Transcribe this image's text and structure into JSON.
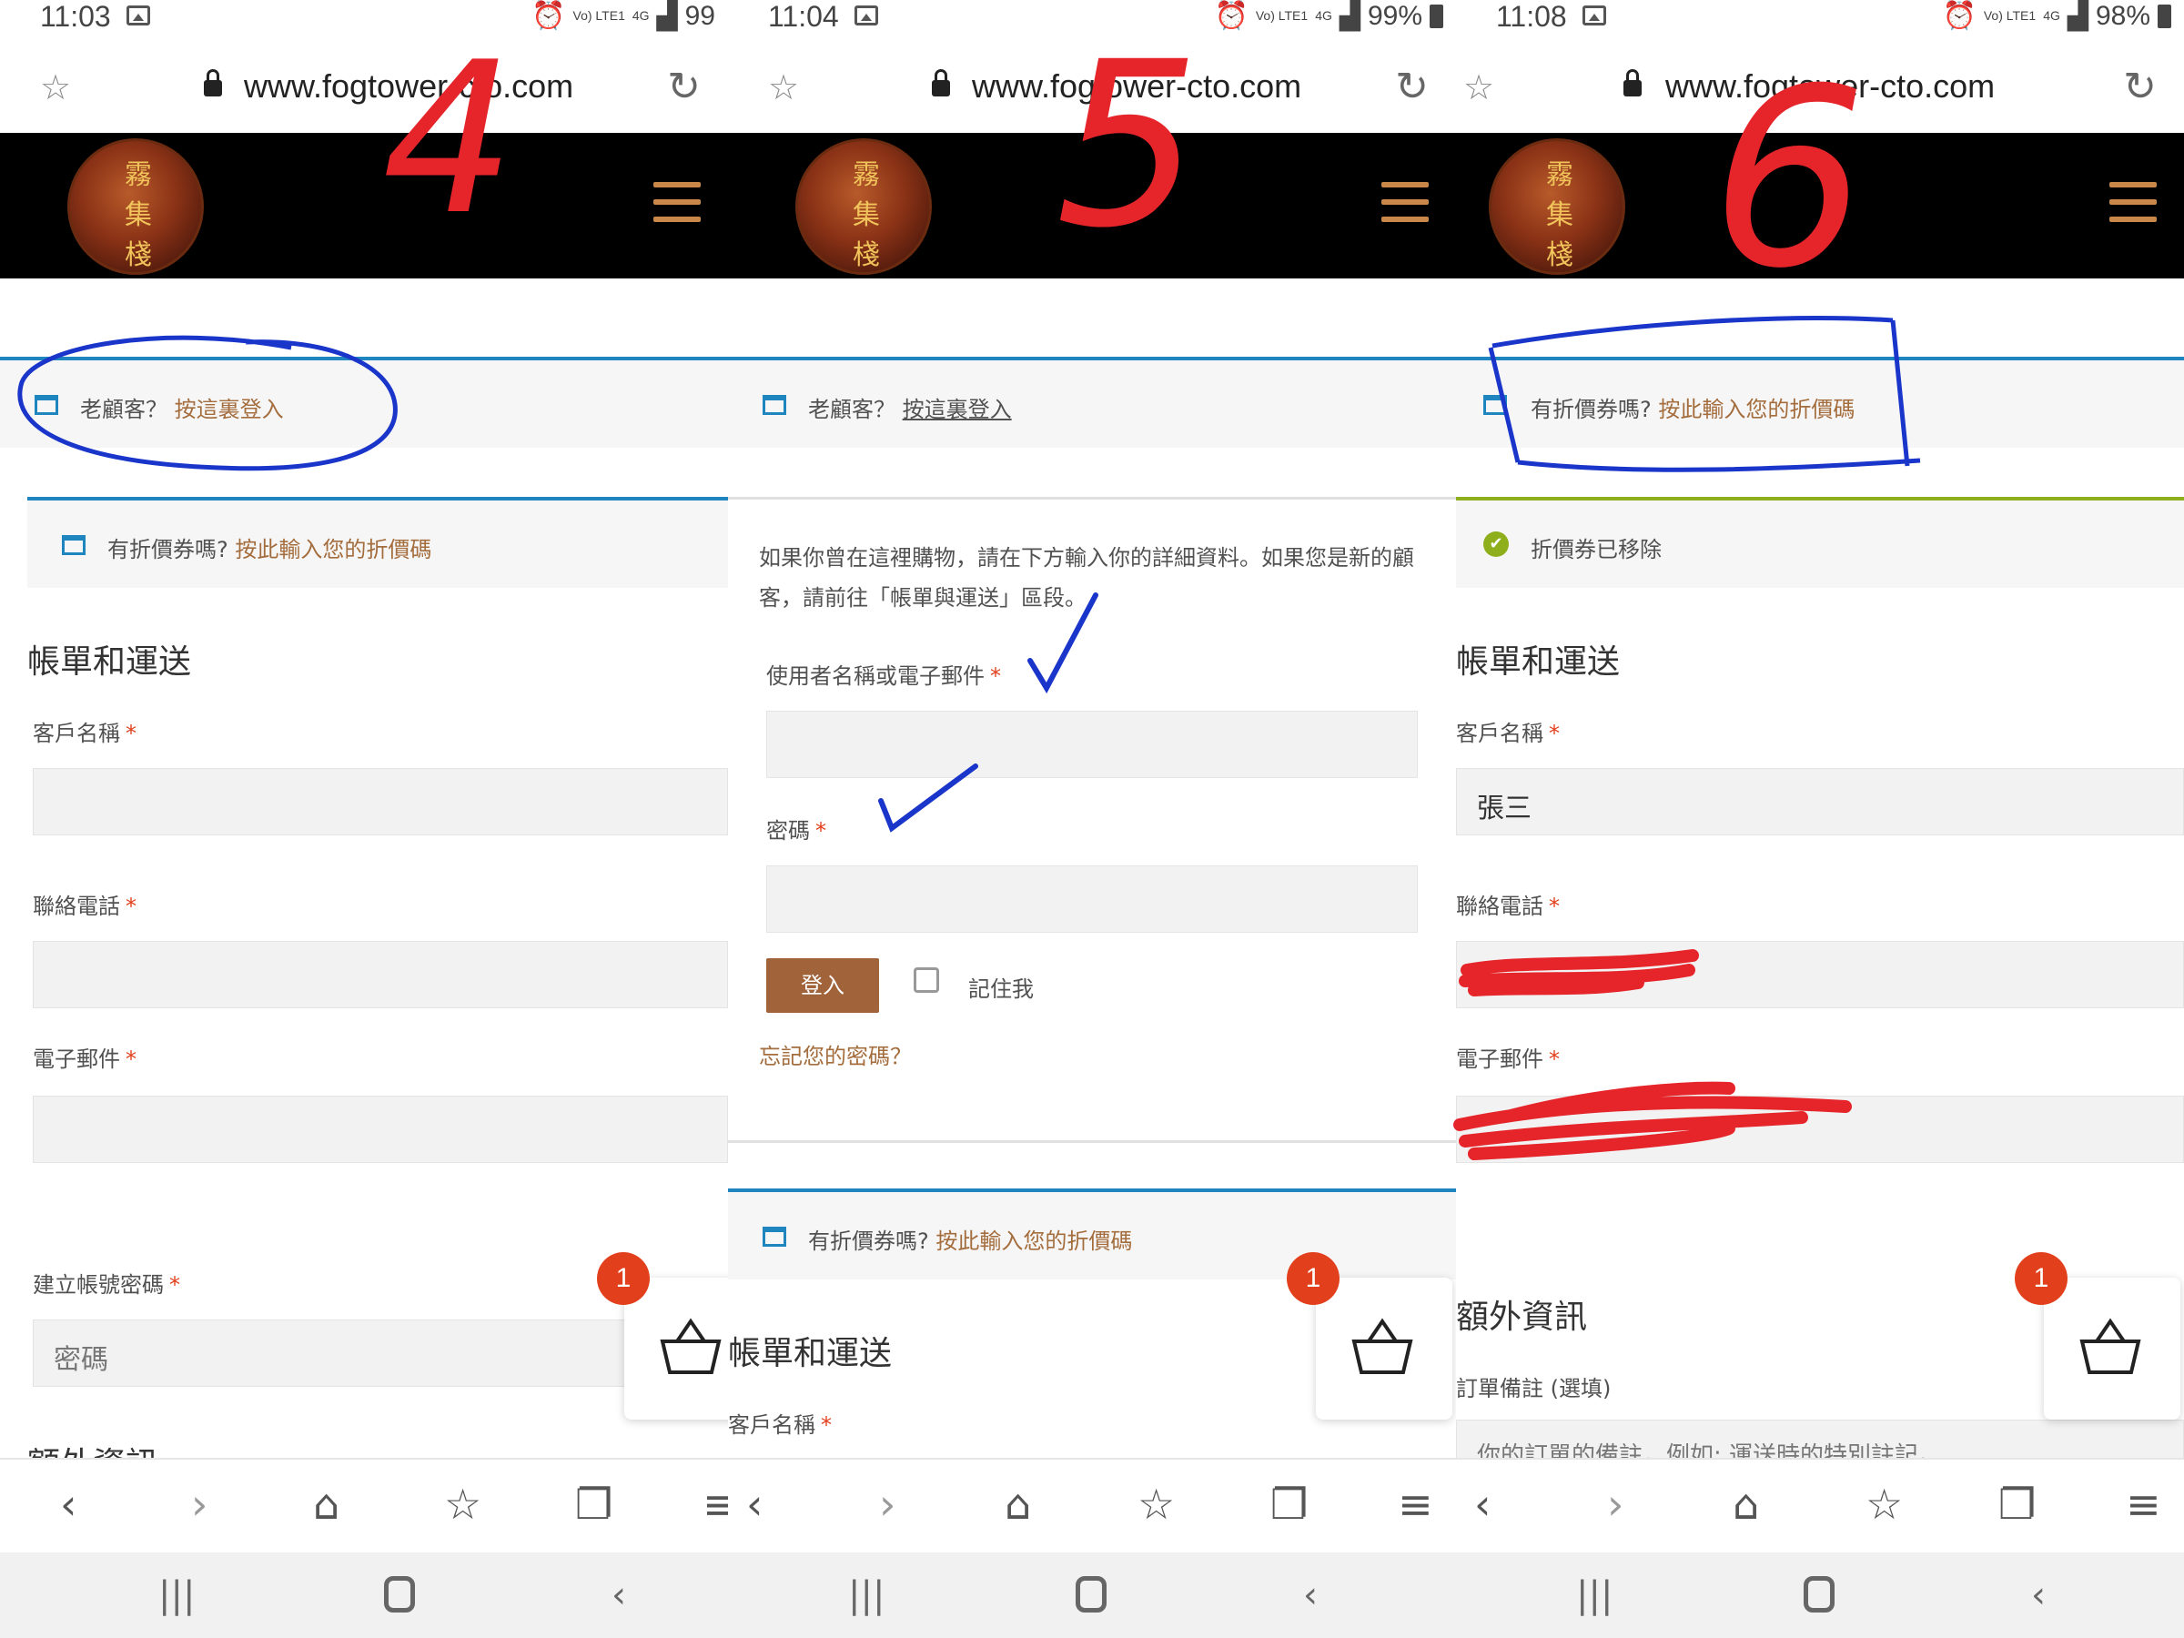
{
  "screens": [
    {
      "status": {
        "time": "11:03",
        "net": "Vo) LTE1",
        "gen": "4G",
        "battery": "99"
      },
      "browser": {
        "url": "www.fogtower-cto.com"
      },
      "logo_chars": [
        "霧",
        "集",
        "棧"
      ],
      "notices": [
        {
          "text": "老顧客？",
          "link": "按這裏登入"
        },
        {
          "text": "有折價券嗎?",
          "link": "按此輸入您的折價碼"
        }
      ],
      "section_title": "帳單和運送",
      "fields": [
        {
          "label": "客戶名稱",
          "value": ""
        },
        {
          "label": "聯絡電話",
          "value": ""
        },
        {
          "label": "電子郵件",
          "value": ""
        },
        {
          "label": "建立帳號密碼",
          "placeholder": "密碼"
        }
      ],
      "cart_count": "1",
      "next_title": "額外資訊"
    },
    {
      "status": {
        "time": "11:04",
        "net": "Vo) LTE1",
        "gen": "4G",
        "battery": "99%"
      },
      "browser": {
        "url": "www.fogtower-cto.com"
      },
      "logo_chars": [
        "霧",
        "集",
        "棧"
      ],
      "notices": [
        {
          "text": "老顧客？",
          "link": "按這裏登入"
        },
        {
          "text": "有折價券嗎?",
          "link": "按此輸入您的折價碼"
        }
      ],
      "login": {
        "intro": "如果你曾在這裡購物，請在下方輸入你的詳細資料。如果您是新的顧客，請前往「帳單與運送」區段。",
        "username_label": "使用者名稱或電子郵件",
        "password_label": "密碼",
        "submit": "登入",
        "remember": "記住我",
        "forgot": "忘記您的密碼？"
      },
      "section_title": "帳單和運送",
      "fields": [
        {
          "label": "客戶名稱"
        }
      ],
      "cart_count": "1"
    },
    {
      "status": {
        "time": "11:08",
        "net": "Vo) LTE1",
        "gen": "4G",
        "battery": "98%"
      },
      "browser": {
        "url": "www.fogtower-cto.com"
      },
      "logo_chars": [
        "霧",
        "集",
        "棧"
      ],
      "notices": [
        {
          "text": "有折價券嗎?",
          "link": "按此輸入您的折價碼"
        },
        {
          "text": "折價券已移除",
          "link": ""
        }
      ],
      "section_title": "帳單和運送",
      "fields": [
        {
          "label": "客戶名稱",
          "value": "張三"
        },
        {
          "label": "聯絡電話",
          "value": ""
        },
        {
          "label": "電子郵件",
          "value": ""
        }
      ],
      "extra_title": "額外資訊",
      "notes_label": "訂單備註 (選填)",
      "notes_placeholder": "你的訂單的備註，例如: 運送時的特別註記。",
      "cart_count": "1"
    }
  ],
  "annotations": {
    "numbers": [
      "4",
      "5",
      "6"
    ],
    "ink_color_red": "#e5252a",
    "ink_color_blue": "#1a35c9"
  },
  "icons": {
    "bookmark": "star-icon",
    "secure": "lock-icon",
    "reload": "reload-icon",
    "menu": "hamburger-icon",
    "cart": "basket-icon"
  },
  "colors": {
    "header_bg": "#000000",
    "accent_link": "#a46d3d",
    "notice_border": "#1e85be",
    "success_border": "#8fae1b",
    "button_bg": "#a0633a",
    "badge": "#e2401c"
  }
}
